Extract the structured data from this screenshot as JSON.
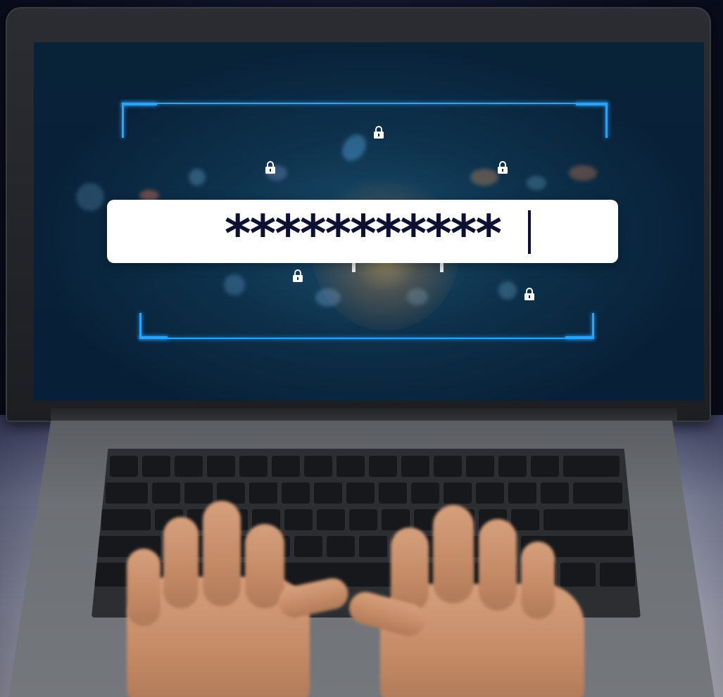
{
  "password_field": {
    "masked_value": "***********"
  },
  "icons": {
    "lock": "lock-icon",
    "shield": "shield-icon"
  },
  "colors": {
    "frame_accent": "#2aa3ff",
    "field_text": "#0e1033",
    "field_background": "#ffffff"
  }
}
